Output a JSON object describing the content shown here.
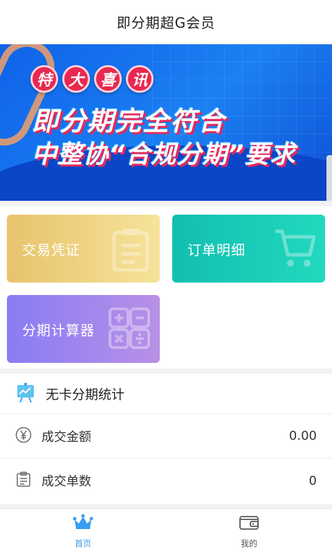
{
  "app": {
    "title": "即分期超G会员"
  },
  "banner": {
    "badges": [
      "特",
      "大",
      "喜",
      "讯"
    ],
    "headline1": "即分期完全符合",
    "headline2": "中整协“合规分期”要求"
  },
  "cards": {
    "voucher_label": "交易凭证",
    "order_label": "订单明细",
    "calculator_label": "分期计算器"
  },
  "stats": {
    "title": "无卡分期统计",
    "rows": [
      {
        "label": "成交金额",
        "value": "0.00",
        "icon": "yen-circle-icon"
      },
      {
        "label": "成交单数",
        "value": "0",
        "icon": "clipboard-icon"
      }
    ]
  },
  "nav": {
    "items": [
      {
        "label": "首页",
        "icon": "crown-icon",
        "active": true
      },
      {
        "label": "我的",
        "icon": "wallet-icon",
        "active": false
      }
    ]
  },
  "colors": {
    "accent": "#3a9df0",
    "banner_blue": "#1b80f2",
    "voucher_card": "#e8c36c",
    "order_card": "#12bfb1",
    "calc_card": "#8a7cf4"
  }
}
